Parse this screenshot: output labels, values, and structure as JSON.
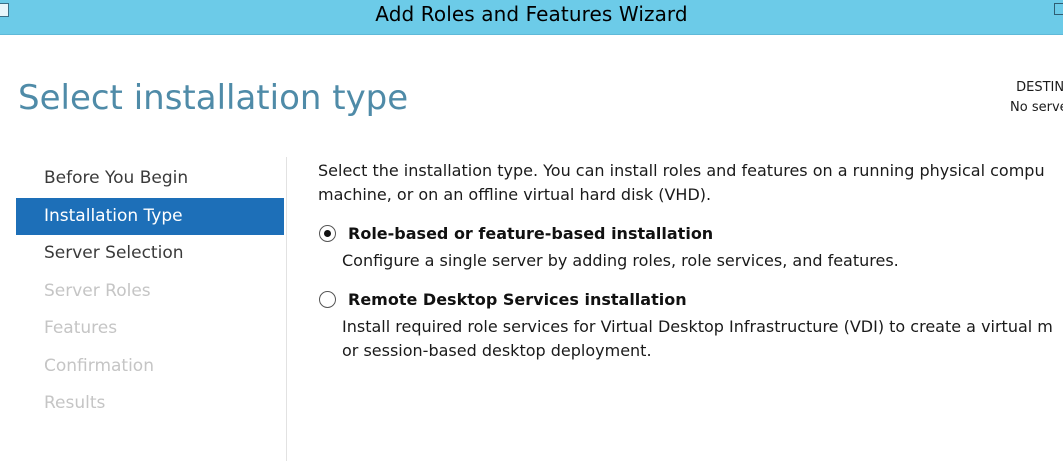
{
  "window": {
    "title": "Add Roles and Features Wizard"
  },
  "header": {
    "page_title": "Select installation type",
    "destination_label": "DESTINA",
    "destination_value": "No server"
  },
  "sidebar": {
    "items": [
      {
        "label": "Before You Begin",
        "state": "normal"
      },
      {
        "label": "Installation Type",
        "state": "active"
      },
      {
        "label": "Server Selection",
        "state": "normal"
      },
      {
        "label": "Server Roles",
        "state": "disabled"
      },
      {
        "label": "Features",
        "state": "disabled"
      },
      {
        "label": "Confirmation",
        "state": "disabled"
      },
      {
        "label": "Results",
        "state": "disabled"
      }
    ]
  },
  "main": {
    "intro_line1": "Select the installation type. You can install roles and features on a running physical compu",
    "intro_line2": "machine, or on an offline virtual hard disk (VHD).",
    "options": [
      {
        "title": "Role-based or feature-based installation",
        "desc_line1": "Configure a single server by adding roles, role services, and features.",
        "selected": true
      },
      {
        "title": "Remote Desktop Services installation",
        "desc_line1": "Install required role services for Virtual Desktop Infrastructure (VDI) to create a virtual m",
        "desc_line2": "or session-based desktop deployment.",
        "selected": false
      }
    ]
  },
  "colors": {
    "titlebar": "#6ccbe8",
    "page_title": "#4f8ba8",
    "active_nav": "#1d6fb8",
    "disabled_nav": "#c5c5c5"
  }
}
